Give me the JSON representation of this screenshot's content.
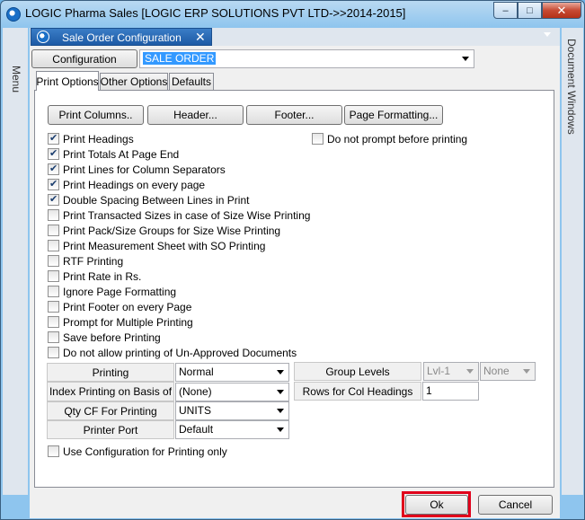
{
  "window": {
    "title": "LOGIC Pharma Sales  [LOGIC ERP SOLUTIONS PVT LTD->>2014-2015]",
    "minimize": "–",
    "maximize": "□",
    "close": "✕"
  },
  "side_menu": {
    "label": "Menu"
  },
  "side_docwin": {
    "label": "Document Windows"
  },
  "doc_tab": {
    "label": "Sale Order Configuration",
    "close": "✕"
  },
  "header": {
    "config_button": "Configuration",
    "config_value": "SALE ORDER"
  },
  "tabs": [
    "Print Options",
    "Other Options",
    "Defaults"
  ],
  "toolbar": {
    "print_columns": "Print Columns..",
    "header": "Header...",
    "footer": "Footer...",
    "page_formatting": "Page Formatting..."
  },
  "options": [
    {
      "label": "Print Headings",
      "checked": true
    },
    {
      "label": "Print Totals At Page End",
      "checked": true
    },
    {
      "label": "Print Lines for Column Separators",
      "checked": true
    },
    {
      "label": "Print Headings on every page",
      "checked": true
    },
    {
      "label": "Double Spacing Between Lines in Print",
      "checked": true
    },
    {
      "label": "Print Transacted Sizes in case of Size Wise Printing",
      "checked": false
    },
    {
      "label": "Print Pack/Size Groups for Size Wise Printing",
      "checked": false
    },
    {
      "label": "Print Measurement Sheet with SO Printing",
      "checked": false
    },
    {
      "label": "RTF Printing",
      "checked": false
    },
    {
      "label": "Print Rate in Rs.",
      "checked": false
    },
    {
      "label": "Ignore Page Formatting",
      "checked": false
    },
    {
      "label": "Print Footer on every Page",
      "checked": false
    },
    {
      "label": "Prompt for Multiple Printing",
      "checked": false
    },
    {
      "label": "Save before Printing",
      "checked": false
    },
    {
      "label": "Do not allow printing of Un-Approved Documents",
      "checked": false
    }
  ],
  "no_prompt": {
    "label": "Do not prompt before printing",
    "checked": false
  },
  "settings": {
    "printing_label": "Printing",
    "printing_value": "Normal",
    "index_label": "Index Printing on Basis of",
    "index_value": "(None)",
    "qty_label": "Qty CF For Printing",
    "qty_value": "UNITS",
    "port_label": "Printer Port",
    "port_value": "Default",
    "group_levels_label": "Group Levels",
    "group_levels_value": "Lvl-1",
    "group_levels_value2": "None",
    "rows_label": "Rows for Col Headings",
    "rows_value": "1"
  },
  "use_config": {
    "label": "Use Configuration for Printing only",
    "checked": false
  },
  "footer": {
    "ok": "Ok",
    "cancel": "Cancel"
  }
}
